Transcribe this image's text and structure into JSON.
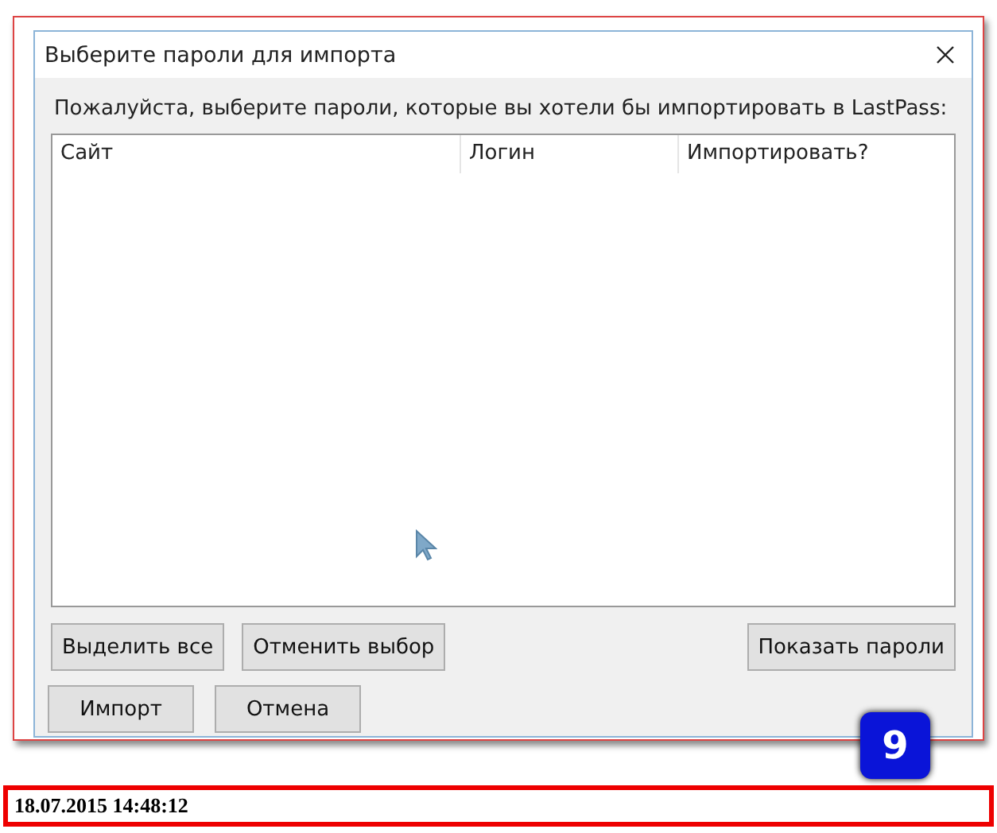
{
  "window": {
    "title": "Выберите пароли для импорта"
  },
  "instructions": "Пожалуйста, выберите пароли, которые вы хотели бы импортировать в LastPass:",
  "table": {
    "columns": [
      "Сайт",
      "Логин",
      "Импортировать?"
    ]
  },
  "selection_buttons": [
    "Выделить все",
    "Отменить выбор"
  ],
  "show_passwords_button": "Показать пароли",
  "buttons": [
    "Импорт",
    "Отмена"
  ],
  "step_badge": "9",
  "timestamp": "18.07.2015 14:48:12"
}
